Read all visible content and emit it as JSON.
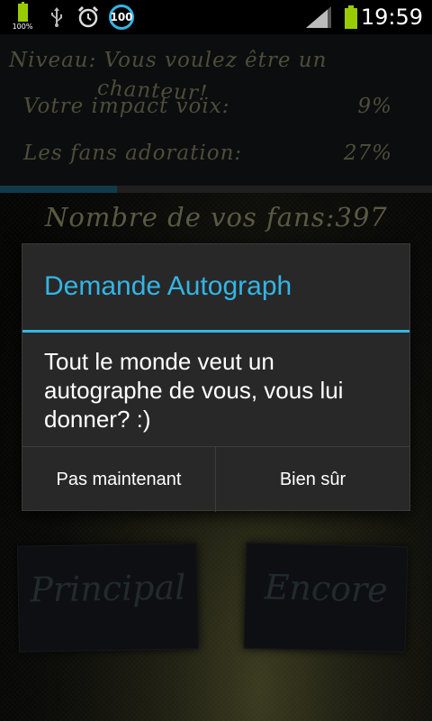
{
  "status_bar": {
    "battery_small_label": "100%",
    "notification_badge": "100",
    "time": "19:59",
    "icons": [
      "battery-icon",
      "usb-icon",
      "alarm-clock-icon",
      "battery-percent-icon",
      "signal-icon",
      "battery-icon"
    ],
    "accent_color": "#33b5e5",
    "battery_color": "#99cc00"
  },
  "stats": {
    "niveau": "Niveau: Vous voulez être un",
    "niveau_overlap": "chanteur!",
    "impact_label": "Votre impact voix:",
    "impact_value": "9%",
    "fans_label": "Les fans adoration:",
    "fans_value": "27%",
    "progress": 0.27,
    "fan_count": "Nombre de vos fans:397"
  },
  "buttons": {
    "principal": "Principal",
    "encore": "Encore"
  },
  "dialog": {
    "title": "Demande Autograph",
    "message": "Tout le monde veut un autographe de vous, vous lui donner? :)",
    "negative": "Pas maintenant",
    "positive": "Bien sûr"
  }
}
